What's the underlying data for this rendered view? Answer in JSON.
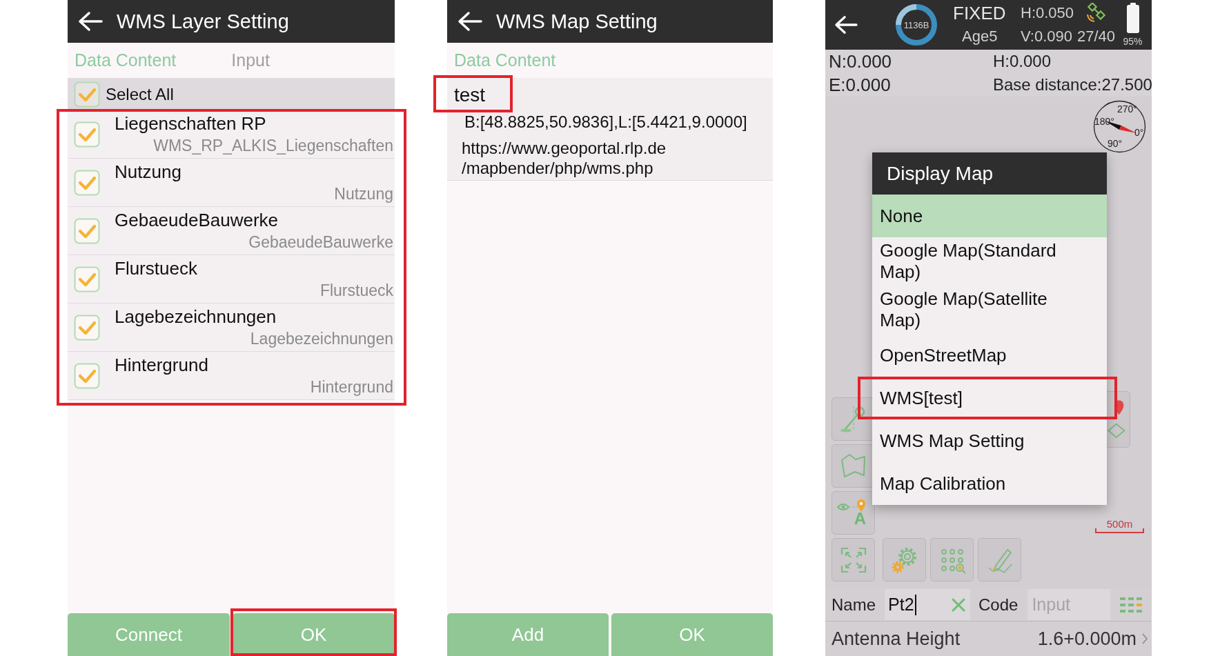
{
  "layer_setting": {
    "title": "WMS Layer Setting",
    "tabs": [
      {
        "label": "Data Content",
        "selected": true
      },
      {
        "label": "Input",
        "selected": false
      }
    ],
    "select_all": {
      "label": "Select All",
      "checked": true
    },
    "layers": {
      "highlighted": true,
      "items": [
        {
          "name": "Liegenschaften RP",
          "layer_id": "WMS_RP_ALKIS_Liegenschaften",
          "checked": true
        },
        {
          "name": "Nutzung",
          "layer_id": "Nutzung",
          "checked": true
        },
        {
          "name": "GebaeudeBauwerke",
          "layer_id": "GebaeudeBauwerke",
          "checked": true
        },
        {
          "name": "Flurstueck",
          "layer_id": "Flurstueck",
          "checked": true
        },
        {
          "name": "Lagebezeichnungen",
          "layer_id": "Lagebezeichnungen",
          "checked": true
        },
        {
          "name": "Hintergrund",
          "layer_id": "Hintergrund",
          "checked": true
        }
      ]
    },
    "buttons": [
      {
        "label": "Connect",
        "highlighted": false
      },
      {
        "label": "OK",
        "highlighted": true
      }
    ]
  },
  "map_setting": {
    "title": "WMS Map Setting",
    "tabs": [
      {
        "label": "Data Content",
        "selected": true
      }
    ],
    "entries": [
      {
        "name": "test",
        "highlighted": true,
        "bounds": "B:[48.8825,50.9836],L:[5.4421,9.0000]",
        "url_lines": [
          "https://www.geoportal.rlp.de",
          "/mapbender/php/wms.php"
        ]
      }
    ],
    "buttons": [
      {
        "label": "Add",
        "highlighted": false
      },
      {
        "label": "OK",
        "highlighted": false
      }
    ]
  },
  "survey": {
    "status": {
      "data_counter": "1136B",
      "solution": "FIXED",
      "age": "Age5",
      "h_precision": "H:0.050",
      "v_precision": "V:0.090",
      "satellites": "27/40",
      "battery": "95%"
    },
    "coordinates": [
      "N:0.000",
      "H:0.000",
      "E:0.000",
      "Base distance:27.500"
    ],
    "compass_labels": [
      "270°",
      "180°",
      "0°",
      "90°"
    ],
    "scale_label": "500m",
    "map_tool_letter": "A",
    "display_map": {
      "title": "Display Map",
      "items": [
        {
          "label": "None",
          "selected": true,
          "highlighted": false
        },
        {
          "label": "Google Map(Standard Map)",
          "selected": false,
          "highlighted": false
        },
        {
          "label": "Google Map(Satellite Map)",
          "selected": false,
          "highlighted": false
        },
        {
          "label": "OpenStreetMap",
          "selected": false,
          "highlighted": false
        },
        {
          "label": "WMS[test]",
          "selected": false,
          "highlighted": true
        },
        {
          "label": "WMS Map Setting",
          "selected": false,
          "highlighted": false
        },
        {
          "label": "Map Calibration",
          "selected": false,
          "highlighted": false
        }
      ]
    },
    "point": {
      "name_label": "Name",
      "name_value": "Pt2",
      "code_label": "Code",
      "code_placeholder": "Input"
    },
    "antenna_height": {
      "label": "Antenna Height",
      "value": "1.6+0.000m"
    }
  }
}
